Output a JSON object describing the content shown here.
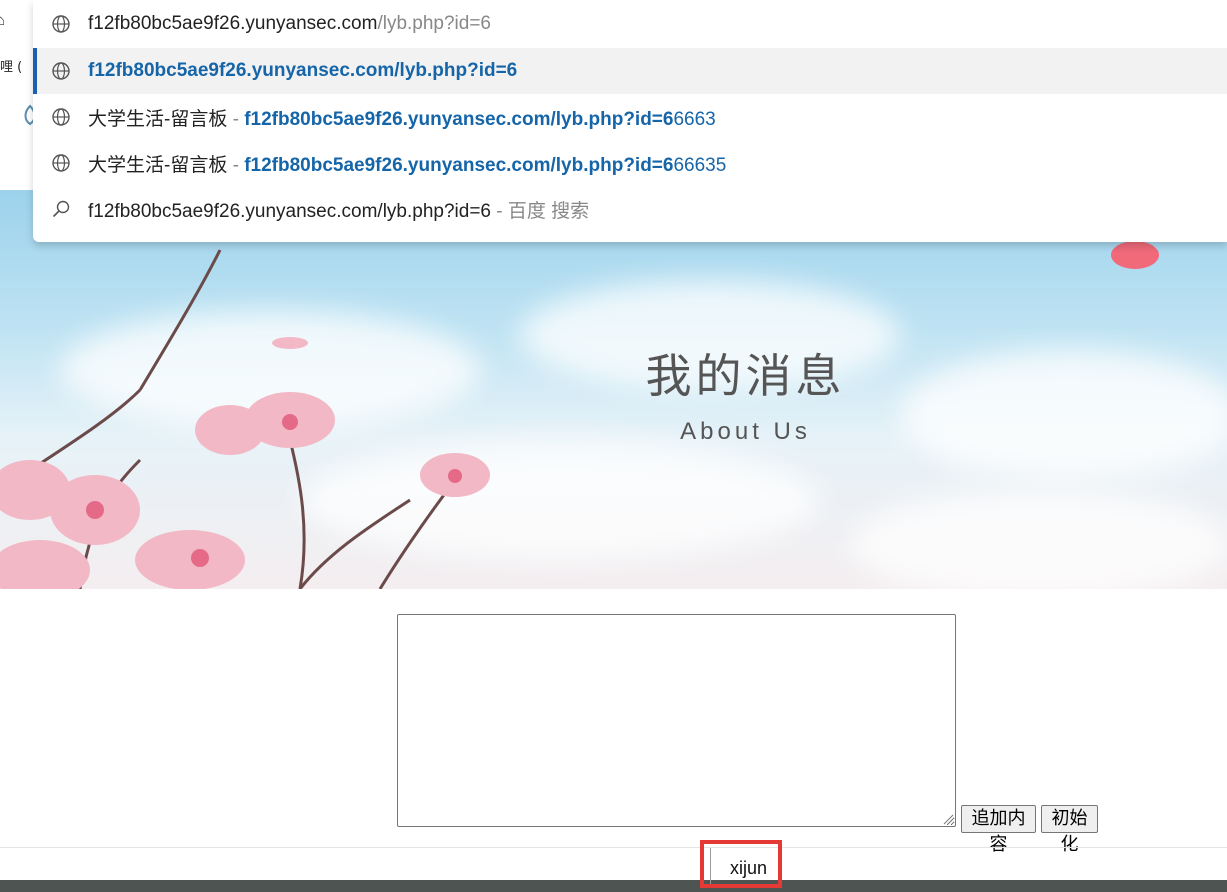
{
  "browser_edge": {
    "tab_fragment": "哩 ("
  },
  "omnibox": {
    "input": {
      "typed": "f12fb80bc5ae9f26.yunyansec.com",
      "completion": "/lyb.php?id=6"
    },
    "suggestions": [
      {
        "type": "url",
        "url": "f12fb80bc5ae9f26.yunyansec.com/lyb.php?id=6"
      },
      {
        "type": "history",
        "title": "大学生活-留言板",
        "sep": " - ",
        "match": "f12fb80bc5ae9f26.yunyansec.com/lyb.php?id=6",
        "rest": "6663"
      },
      {
        "type": "history",
        "title": "大学生活-留言板",
        "sep": " - ",
        "match": "f12fb80bc5ae9f26.yunyansec.com/lyb.php?id=6",
        "rest": "66635"
      },
      {
        "type": "search",
        "query": "f12fb80bc5ae9f26.yunyansec.com/lyb.php?id=6",
        "engine": " - 百度 搜索"
      }
    ]
  },
  "hero": {
    "title": "我的消息",
    "subtitle": "About Us"
  },
  "form": {
    "message_value": "",
    "append_button": "追加内容",
    "init_button": "初始化"
  },
  "user": {
    "name": "xijun"
  },
  "colors": {
    "selected_bar": "#1a5fb4",
    "match_text": "#1565a8",
    "highlight": "#e53935",
    "footer": "#4d5452"
  }
}
